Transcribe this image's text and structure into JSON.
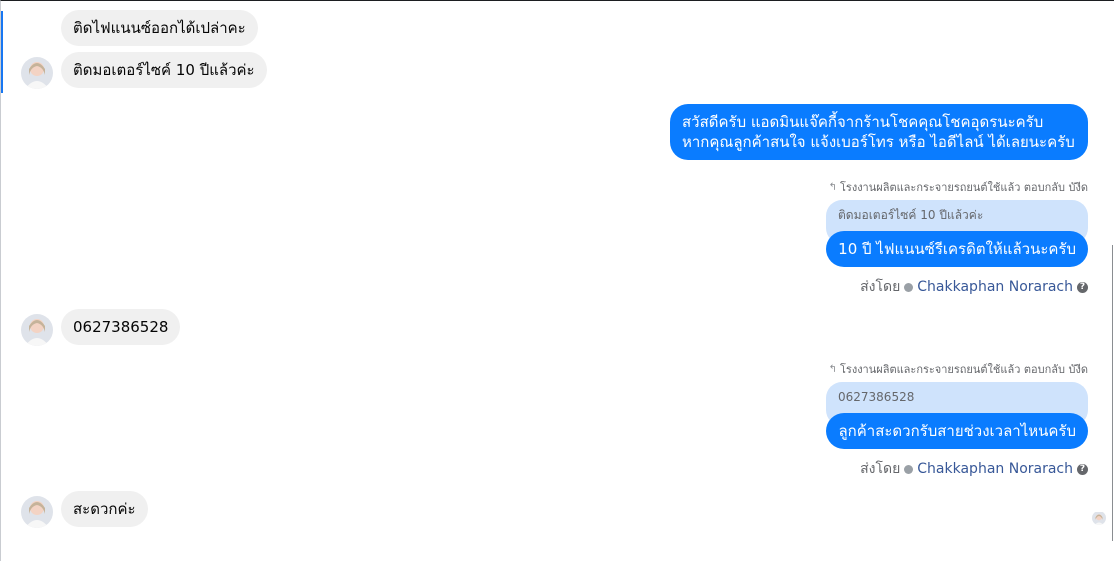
{
  "incoming_messages": [
    {
      "text": "ติดไฟแนนซ์ออกได้เปล่าคะ"
    },
    {
      "text": "ติดมอเตอร์ไซค์ 10 ปีแล้วค่ะ"
    },
    {
      "text": "0627386528"
    },
    {
      "text": "สะดวกค่ะ"
    }
  ],
  "outgoing_messages": [
    {
      "line1": "สวัสดีครับ แอดมินแจ๊คกี้จากร้านโชคคุณโชคอุดรนะครับ",
      "line2": "หากคุณลูกค้าสนใจ แจ้งเบอร์โทร หรือ ไอดีไลน์ ได้เลยนะครับ"
    },
    {
      "reply_header": "โรงงานผลิตและกระจายรถยนต์ใช้แล้ว ตอบกลับ บังีด",
      "quoted": "ติดมอเตอร์ไซค์ 10 ปีแล้วค่ะ",
      "text": "10 ปี ไฟแนนซ์รีเครดิตให้แล้วนะครับ",
      "sent_by_label": "ส่งโดย",
      "sender": "Chakkaphan Norarach"
    },
    {
      "reply_header": "โรงงานผลิตและกระจายรถยนต์ใช้แล้ว ตอบกลับ บังีด",
      "quoted": "0627386528",
      "text": "ลูกค้าสะดวกรับสายช่วงเวลาไหนครับ",
      "sent_by_label": "ส่งโดย",
      "sender": "Chakkaphan Norarach"
    }
  ],
  "icons": {
    "reply": "reply-arrow-icon",
    "verified": "check-circle-icon",
    "help": "question-mark-icon",
    "help_glyph": "?"
  },
  "colors": {
    "outgoing_bubble": "#0a7cff",
    "incoming_bubble": "#f0f0f0",
    "quote_bubble": "#cfe3fc",
    "sender_link": "#385898"
  }
}
